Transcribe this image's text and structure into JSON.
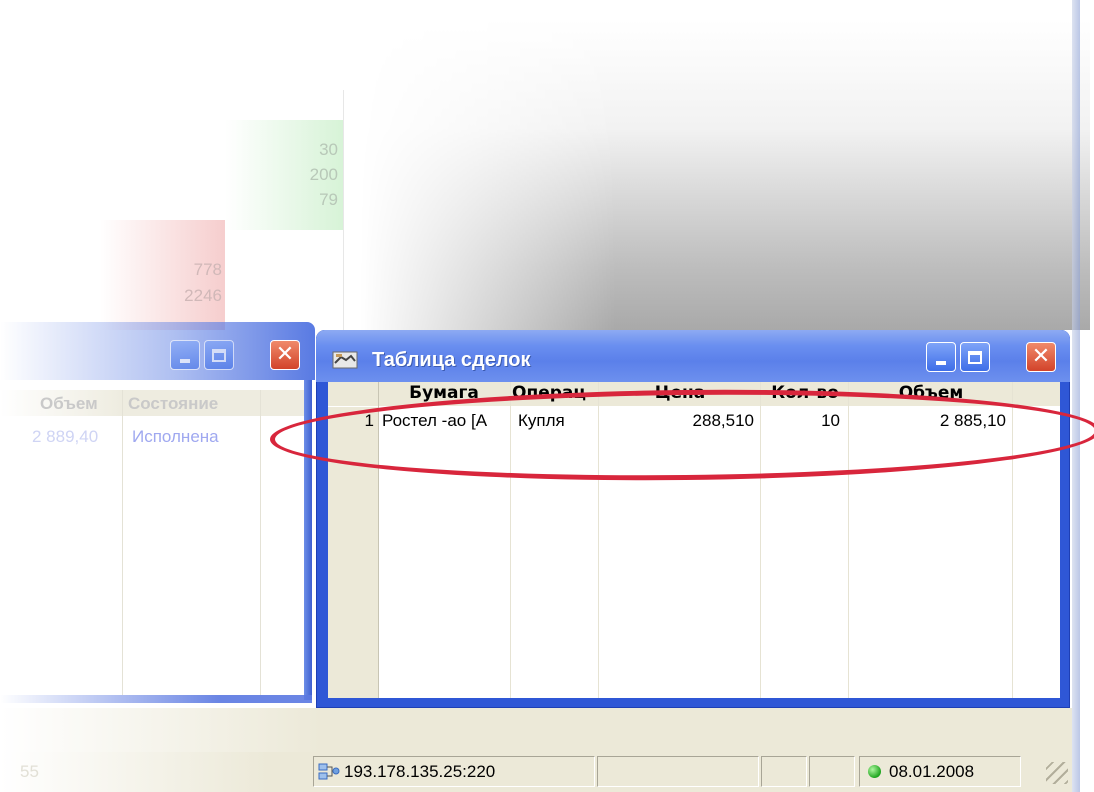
{
  "background_window": {
    "quote_numbers_green": [
      "30",
      "200",
      "79"
    ],
    "quote_numbers_red": [
      "778",
      "2246"
    ]
  },
  "orders_window": {
    "columns": [
      "Объем",
      "Состояние"
    ],
    "row": {
      "volume": "2 889,40",
      "status": "Исполнена"
    },
    "colors": {
      "status_text": "#9fa8f0",
      "value_text": "#cfd4f4"
    }
  },
  "trades_window": {
    "title": "Таблица сделок",
    "title_icon": "handshake-icon",
    "columns": [
      "Бумага",
      "Операц",
      "Цена",
      "Кол-во",
      "Объем"
    ],
    "rows": [
      {
        "num": "1",
        "security": "Ростел -ао [А",
        "operation": "Купля",
        "price": "288,510",
        "qty": "10",
        "volume": "2 885,10"
      }
    ],
    "highlight_color": "#d8263c"
  },
  "statusbar": {
    "faded_text": "55",
    "server": "193.178.135.25:220",
    "server_icon": "network-icon",
    "connection_status_icon": "green-dot-icon",
    "date": "08.01.2008"
  },
  "colors": {
    "title_bar": "#6a8ff0",
    "frame": "#2f57d6",
    "close_button": "#d2432a",
    "panel_bg": "#ece9d8"
  }
}
